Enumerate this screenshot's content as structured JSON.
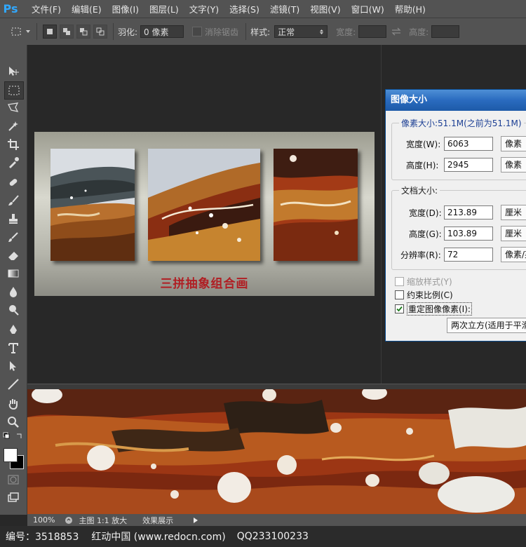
{
  "menubar": {
    "logo": "Ps",
    "items": [
      "文件(F)",
      "编辑(E)",
      "图像(I)",
      "图层(L)",
      "文字(Y)",
      "选择(S)",
      "滤镜(T)",
      "视图(V)",
      "窗口(W)",
      "帮助(H)"
    ]
  },
  "options": {
    "feather_label": "羽化:",
    "feather_value": "0 像素",
    "antialias_label": "消除锯齿",
    "style_label": "样式:",
    "style_value": "正常",
    "width_label": "宽度:",
    "height_label": "高度:"
  },
  "document": {
    "caption": "三拼抽象组合画"
  },
  "dialog": {
    "title": "图像大小",
    "pixel_size_label": "像素大小:51.1M(之前为51.1M)",
    "pixel_width_label": "宽度(W):",
    "pixel_width_value": "6063",
    "pixel_width_unit": "像素",
    "pixel_height_label": "高度(H):",
    "pixel_height_value": "2945",
    "pixel_height_unit": "像素",
    "doc_size_label": "文档大小:",
    "doc_width_label": "宽度(D):",
    "doc_width_value": "213.89",
    "doc_width_unit": "厘米",
    "doc_height_label": "高度(G):",
    "doc_height_value": "103.89",
    "doc_height_unit": "厘米",
    "resolution_label": "分辨率(R):",
    "resolution_value": "72",
    "resolution_unit": "像素/英寸",
    "scale_styles_label": "缩放样式(Y)",
    "constrain_label": "约束比例(C)",
    "resample_label": "重定图像像素(I):",
    "resample_method": "两次立方(适用于平滑渐变)"
  },
  "statusbar": {
    "zoom": "100%",
    "main_label": "主图 1:1 放大",
    "effect_label": "效果展示"
  },
  "footer": {
    "id_text": "编号：3518853",
    "site_text": "红动中国 (www.redocn.com)",
    "qq_text": "QQ233100233"
  },
  "colors": {
    "accent": "#31a8ff",
    "caption_red": "#b01e23",
    "dialog_title": "#2a6bbf"
  }
}
